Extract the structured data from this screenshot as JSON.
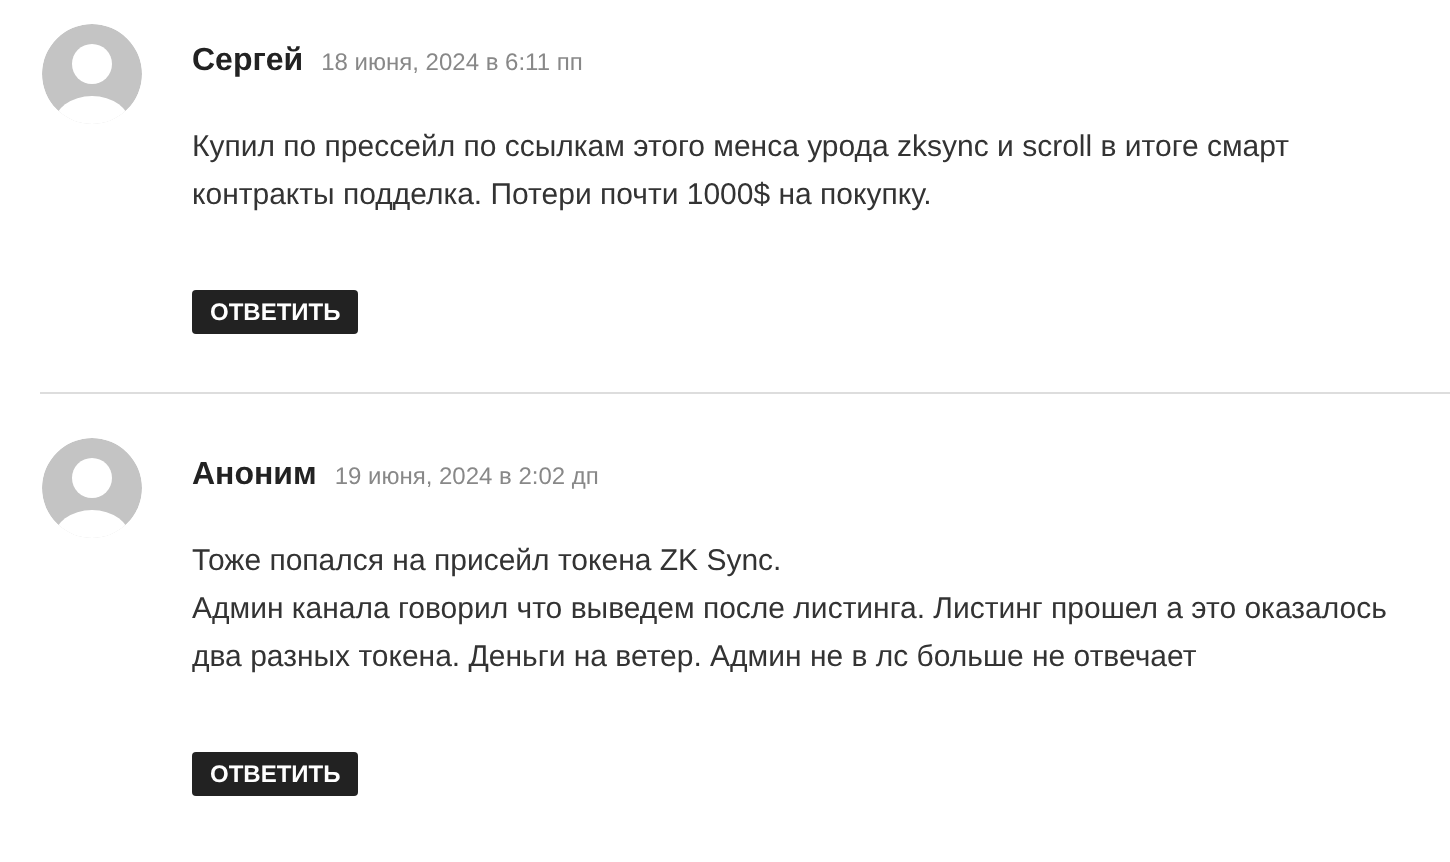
{
  "comments": [
    {
      "author": "Сергей",
      "date": "18 июня, 2024 в 6:11 пп",
      "paragraphs": [
        "Купил по прессейл по ссылкам этого менса урода zksync и scroll в итоге смарт контракты подделка. Потери почти 1000$ на покупку."
      ],
      "reply": "ОТВЕТИТЬ"
    },
    {
      "author": "Аноним",
      "date": "19 июня, 2024 в 2:02 дп",
      "paragraphs": [
        "Тоже попался на присейл токена ZK Sync.",
        "Админ канала говорил что выведем после листинга. Листинг прошел а это оказалось два разных токена. Деньги на ветер. Админ не в лс больше не отвечает"
      ],
      "reply": "ОТВЕТИТЬ"
    }
  ]
}
